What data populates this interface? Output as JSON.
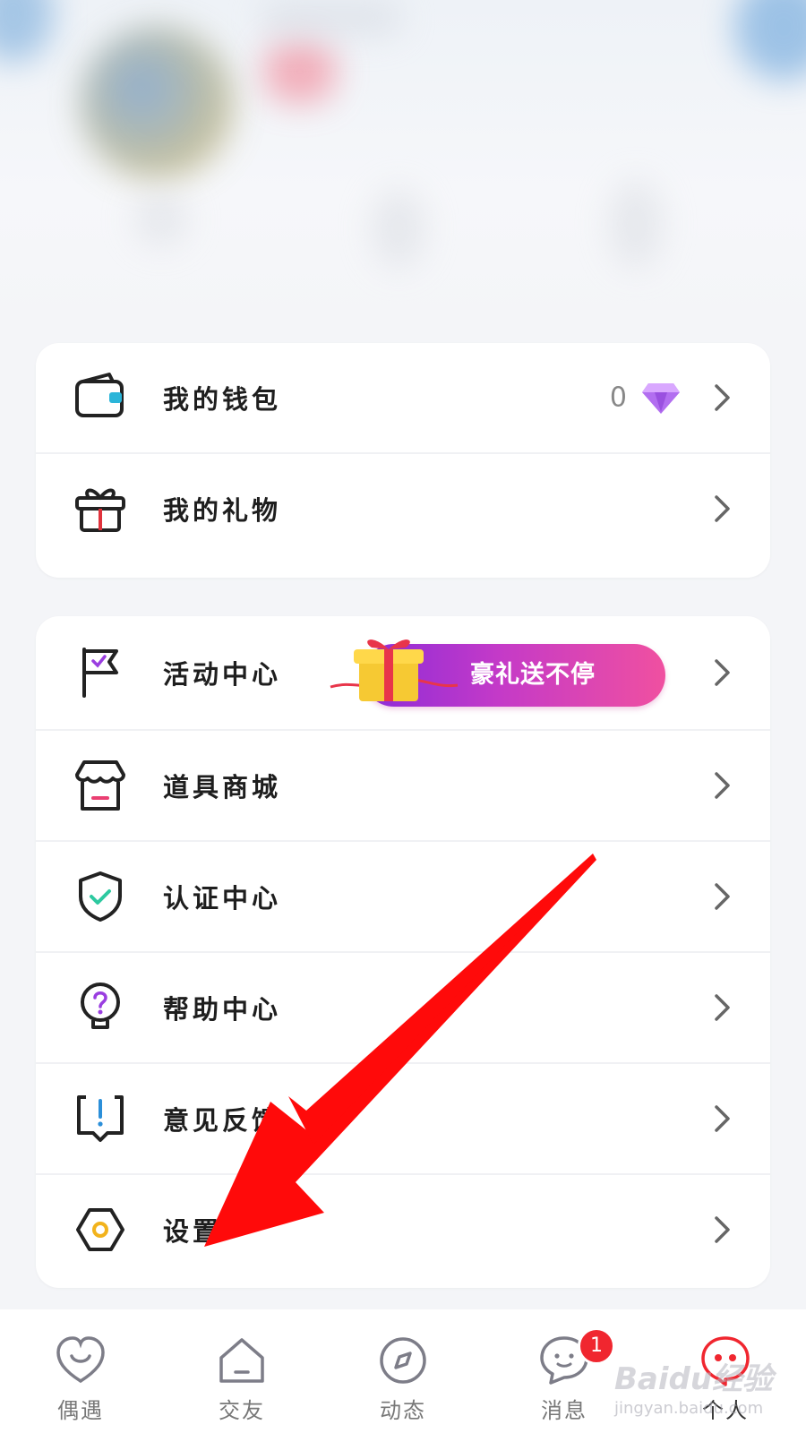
{
  "menu_group_1": [
    {
      "id": "wallet",
      "label": "我的钱包",
      "icon": "wallet-icon",
      "value": "0",
      "value_icon": "diamond-icon"
    },
    {
      "id": "gifts",
      "label": "我的礼物",
      "icon": "gift-box-icon"
    }
  ],
  "menu_group_2": [
    {
      "id": "activity",
      "label": "活动中心",
      "icon": "flag-icon",
      "promo": "豪礼送不停"
    },
    {
      "id": "store",
      "label": "道具商城",
      "icon": "shop-icon"
    },
    {
      "id": "verify",
      "label": "认证中心",
      "icon": "shield-check-icon"
    },
    {
      "id": "help",
      "label": "帮助中心",
      "icon": "question-bulb-icon"
    },
    {
      "id": "feedback",
      "label": "意见反馈",
      "icon": "feedback-icon"
    },
    {
      "id": "settings",
      "label": "设置",
      "icon": "settings-hexagon-icon"
    }
  ],
  "tabbar": [
    {
      "label": "偶遇",
      "icon": "heart-smile-icon"
    },
    {
      "label": "交友",
      "icon": "home-icon"
    },
    {
      "label": "动态",
      "icon": "compass-icon"
    },
    {
      "label": "消息",
      "icon": "chat-face-icon",
      "badge": "1"
    },
    {
      "label": "个人",
      "icon": "profile-face-icon",
      "active": true
    }
  ],
  "watermark": {
    "logo": "Baidu经验",
    "url": "jingyan.baidu.com"
  },
  "colors": {
    "accent": "#f0262f",
    "promo_start": "#8b2bd8",
    "promo_end": "#f050a0",
    "annotation_arrow": "#ff0000"
  }
}
